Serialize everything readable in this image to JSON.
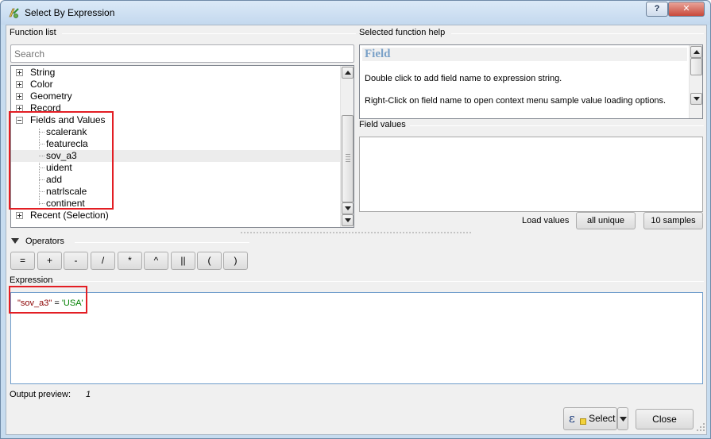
{
  "window": {
    "title": "Select By Expression",
    "help_button": "?",
    "close_button": "✕"
  },
  "function_list": {
    "group_label": "Function list",
    "search_placeholder": "Search",
    "items": [
      {
        "label": "String",
        "expander": "plus"
      },
      {
        "label": "Color",
        "expander": "plus"
      },
      {
        "label": "Geometry",
        "expander": "plus"
      },
      {
        "label": "Record",
        "expander": "plus"
      },
      {
        "label": "Fields and Values",
        "expander": "minus"
      },
      {
        "label": "Recent (Selection)",
        "expander": "plus"
      }
    ],
    "fields": [
      "scalerank",
      "featurecla",
      "sov_a3",
      "uident",
      "add",
      "natrlscale",
      "continent"
    ],
    "selected_field": "sov_a3"
  },
  "help": {
    "group_label": "Selected function help",
    "heading": "Field",
    "line1": "Double click to add field name to expression string.",
    "line2": "Right-Click on field name to open context menu sample value loading options."
  },
  "field_values": {
    "group_label": "Field values",
    "load_label": "Load values",
    "all_unique": "all unique",
    "samples": "10 samples"
  },
  "operators": {
    "label": "Operators",
    "buttons": [
      "=",
      "+",
      "-",
      "/",
      "*",
      "^",
      "||",
      "(",
      ")"
    ]
  },
  "expression": {
    "label": "Expression",
    "field": "\"sov_a3\"",
    "op": " = ",
    "value": "'USA'"
  },
  "output": {
    "label": "Output preview:",
    "value": "1"
  },
  "footer": {
    "select_icon_glyph": "ε",
    "select_label": "Select",
    "close_label": "Close"
  },
  "colors": {
    "highlight": "#e31e24",
    "field_token": "#8b0000",
    "string_token": "#008000",
    "help_heading": "#7aa1c8"
  }
}
